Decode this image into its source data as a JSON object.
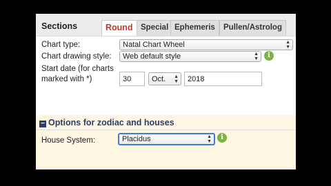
{
  "header": {
    "sections_label": "Sections",
    "tabs": [
      {
        "label": "Round",
        "active": true
      },
      {
        "label": "Special",
        "active": false
      },
      {
        "label": "Ephemeris",
        "active": false
      },
      {
        "label": "Pullen/Astrolog",
        "active": false
      }
    ]
  },
  "form": {
    "chart_type_label": "Chart type:",
    "chart_type_value": "Natal Chart Wheel",
    "drawing_style_label": "Chart drawing style:",
    "drawing_style_value": "Web default style",
    "start_date_label_1": "Start date (for charts",
    "start_date_label_2": "marked with *)",
    "day": "30",
    "month": "Oct.",
    "year": "2018"
  },
  "options": {
    "header": "Options for zodiac and houses",
    "house_system_label": "House System:",
    "house_system_value": "Placidus"
  },
  "icons": {
    "info": "i",
    "minus": "−"
  },
  "colors": {
    "active_tab": "#c0392b",
    "section_header": "#2c3e6b",
    "info_icon": "#7cb342",
    "options_bg": "#fdf6e3"
  }
}
